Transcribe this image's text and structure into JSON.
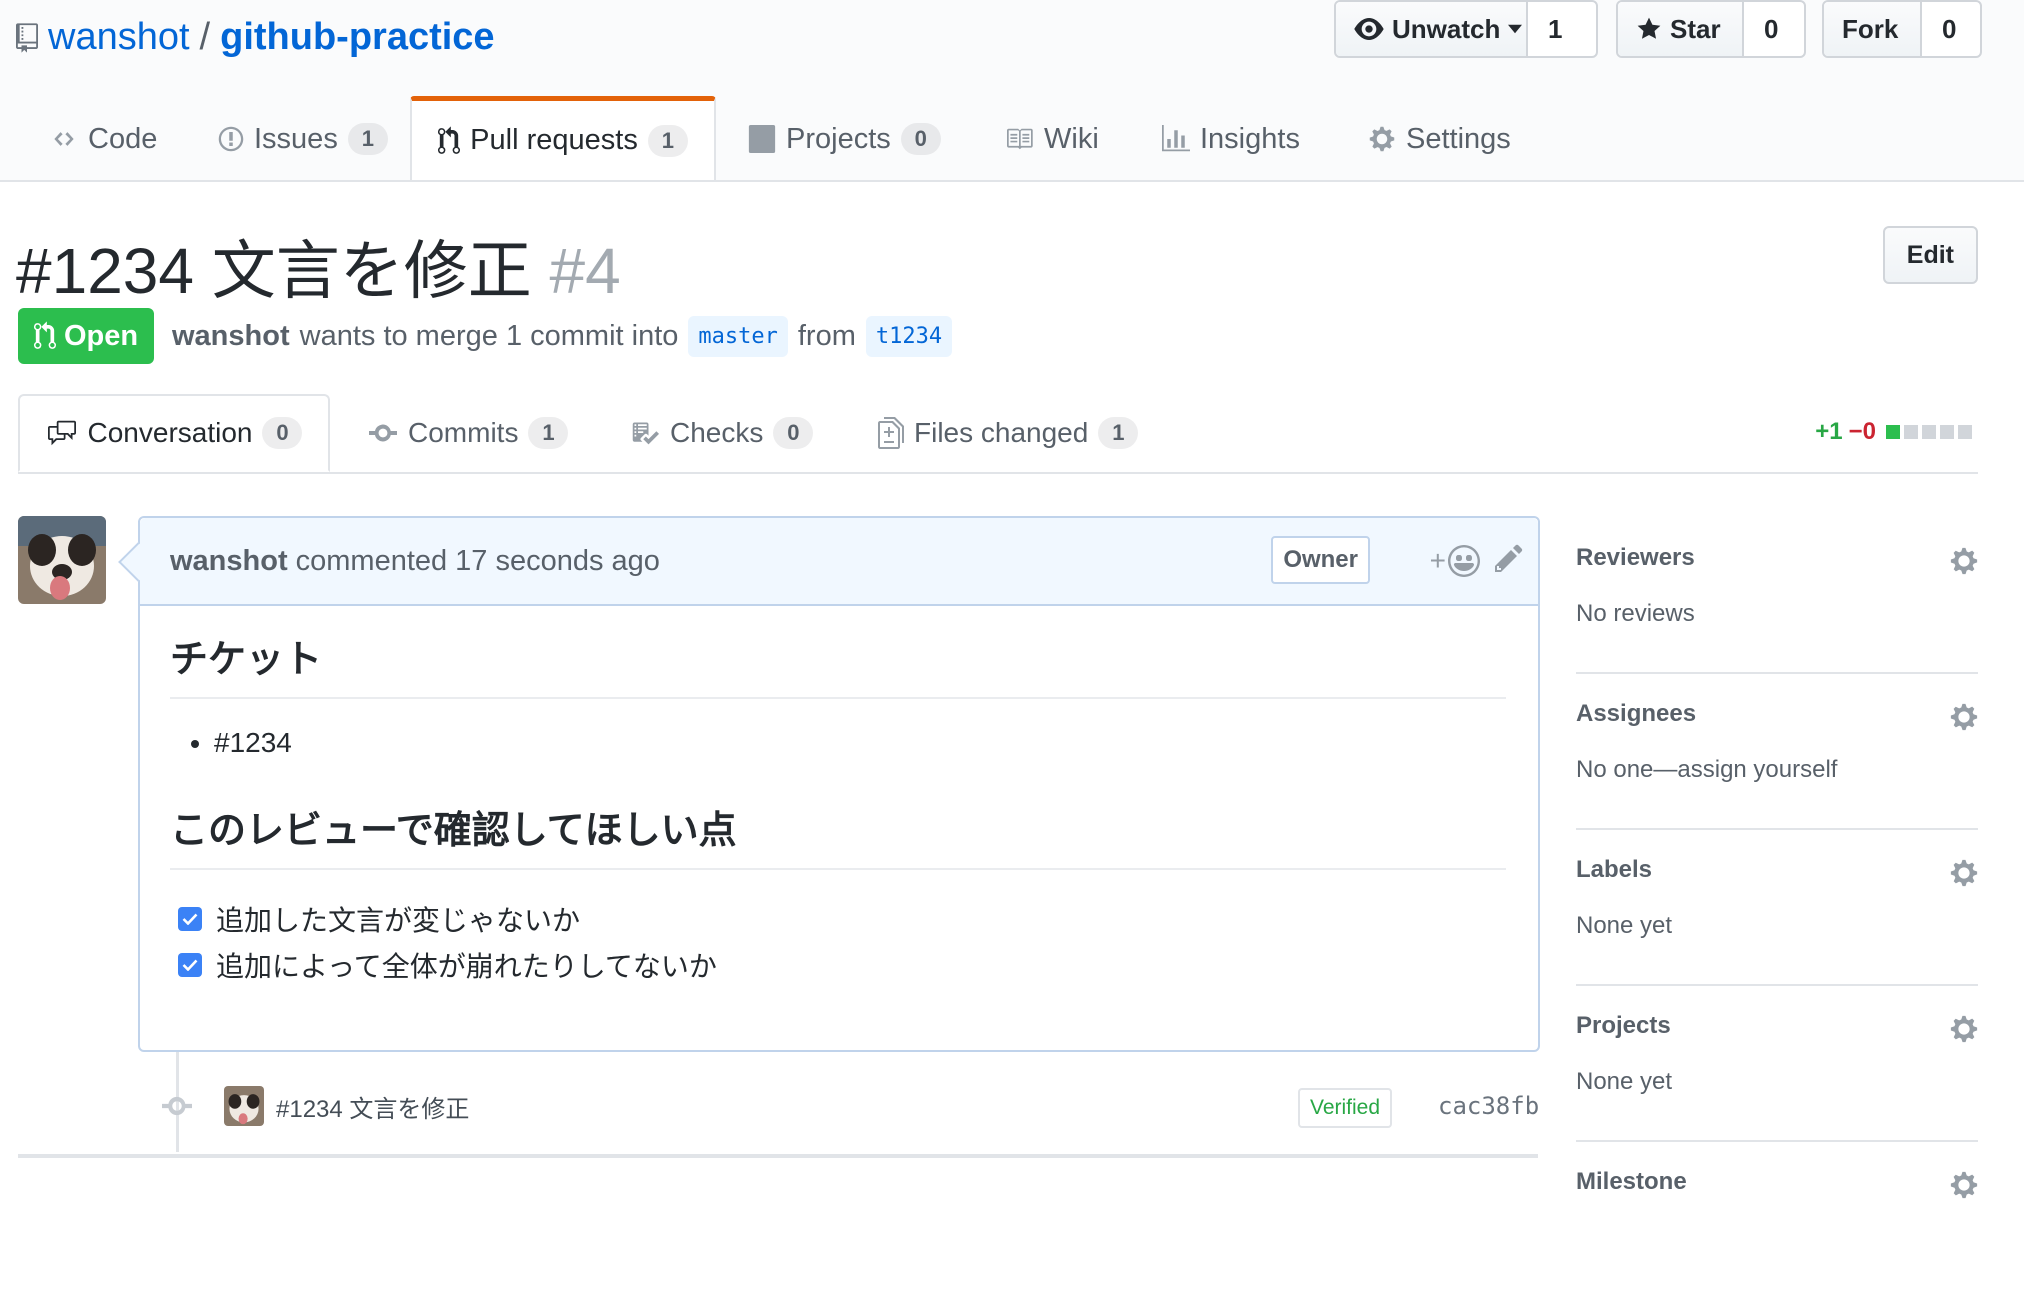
{
  "repo": {
    "owner": "wanshot",
    "separator": "/",
    "name": "github-practice"
  },
  "actions": {
    "watch_label": "Unwatch",
    "watch_count": "1",
    "star_label": "Star",
    "star_count": "0",
    "fork_label": "Fork",
    "fork_count": "0"
  },
  "reponav": [
    {
      "label": "Code",
      "count": null,
      "icon": "code-icon"
    },
    {
      "label": "Issues",
      "count": "1",
      "icon": "issue-icon"
    },
    {
      "label": "Pull requests",
      "count": "1",
      "icon": "pull-request-icon",
      "selected": true
    },
    {
      "label": "Projects",
      "count": "0",
      "icon": "project-icon"
    },
    {
      "label": "Wiki",
      "count": null,
      "icon": "book-icon"
    },
    {
      "label": "Insights",
      "count": null,
      "icon": "graph-icon"
    },
    {
      "label": "Settings",
      "count": null,
      "icon": "gear-icon"
    }
  ],
  "pr": {
    "title": "#1234 文言を修正",
    "number": "#4",
    "edit_label": "Edit",
    "state": "Open",
    "author": "wanshot",
    "merge_text": "wants to merge 1 commit into",
    "base_branch": "master",
    "from_text": "from",
    "head_branch": "t1234"
  },
  "prtabs": [
    {
      "label": "Conversation",
      "count": "0",
      "icon": "comment-discussion-icon",
      "selected": true
    },
    {
      "label": "Commits",
      "count": "1",
      "icon": "git-commit-icon"
    },
    {
      "label": "Checks",
      "count": "0",
      "icon": "checklist-icon"
    },
    {
      "label": "Files changed",
      "count": "1",
      "icon": "diff-icon"
    }
  ],
  "diffstat": {
    "additions": "+1",
    "deletions": "−0",
    "blocks": [
      "green",
      "gray",
      "gray",
      "gray",
      "gray"
    ]
  },
  "comment": {
    "author": "wanshot",
    "action": "commented",
    "time": "17 seconds ago",
    "badge": "Owner",
    "reaction_plus": "+",
    "heading1": "チケット",
    "list": [
      "#1234"
    ],
    "heading2": "このレビューで確認してほしい点",
    "tasks": [
      {
        "text": "追加した文言が変じゃないか",
        "checked": true
      },
      {
        "text": "追加によって全体が崩れたりしてないか",
        "checked": true
      }
    ]
  },
  "commit": {
    "message": "#1234  文言を修正",
    "verified": "Verified",
    "sha": "cac38fb"
  },
  "sidebar": [
    {
      "heading": "Reviewers",
      "value": "No reviews"
    },
    {
      "heading": "Assignees",
      "value": "No one—assign yourself"
    },
    {
      "heading": "Labels",
      "value": "None yet"
    },
    {
      "heading": "Projects",
      "value": "None yet"
    },
    {
      "heading": "Milestone",
      "value": ""
    }
  ],
  "colors": {
    "link": "#0366d6",
    "open_green": "#2cbe4e",
    "tab_accent": "#e36209",
    "comment_header_bg": "#f1f8ff",
    "comment_border": "#c0d3eb",
    "addition": "#28a745",
    "deletion": "#cb2431"
  }
}
